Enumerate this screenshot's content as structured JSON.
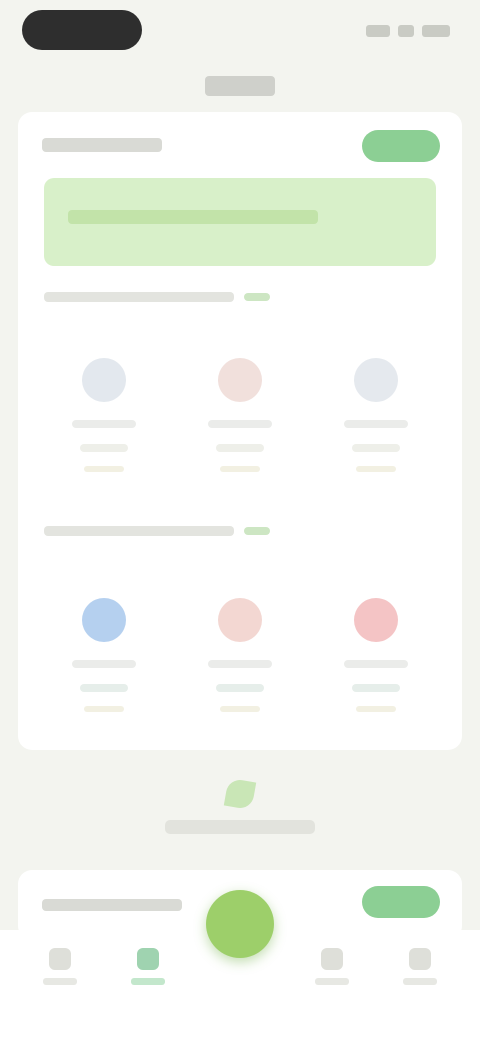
{
  "status_bar": {
    "pill": ""
  },
  "header": {
    "title": ""
  },
  "main_card": {
    "title": "",
    "action_button": "",
    "banner_text": "",
    "section1": {
      "title": "",
      "link": "",
      "tiles": [
        {
          "icon": "person-icon",
          "label": "",
          "value": "",
          "sub": "",
          "accent": "#c9d3dd"
        },
        {
          "icon": "person-icon",
          "label": "",
          "value": "",
          "sub": "",
          "accent": "#e8cbc4"
        },
        {
          "icon": "person-icon",
          "label": "",
          "value": "",
          "sub": "",
          "accent": "#cfd6df"
        }
      ]
    },
    "section2": {
      "title": "",
      "link": "",
      "tiles": [
        {
          "icon": "circle-icon",
          "label": "",
          "value": "",
          "sub": "",
          "accent": "#a8c8ec"
        },
        {
          "icon": "circle-icon",
          "label": "",
          "value": "",
          "sub": "",
          "accent": "#f0c9c4"
        },
        {
          "icon": "circle-icon",
          "label": "",
          "value": "",
          "sub": "",
          "accent": "#f2b3b4"
        }
      ]
    }
  },
  "empty_state": {
    "icon": "leaf-icon",
    "label": ""
  },
  "second_card": {
    "title": "",
    "action_button": ""
  },
  "tabbar": {
    "tabs": [
      {
        "icon": "home-icon",
        "label": ""
      },
      {
        "icon": "chart-icon",
        "label": "",
        "active": true
      },
      {
        "icon": "message-icon",
        "label": ""
      },
      {
        "icon": "user-icon",
        "label": ""
      }
    ],
    "fab_icon": "plus-icon"
  },
  "colors": {
    "background": "#f3f4ef",
    "accent_green": "#8ccf94",
    "banner": "#d8f0c9",
    "fab": "#9dcf6a"
  }
}
